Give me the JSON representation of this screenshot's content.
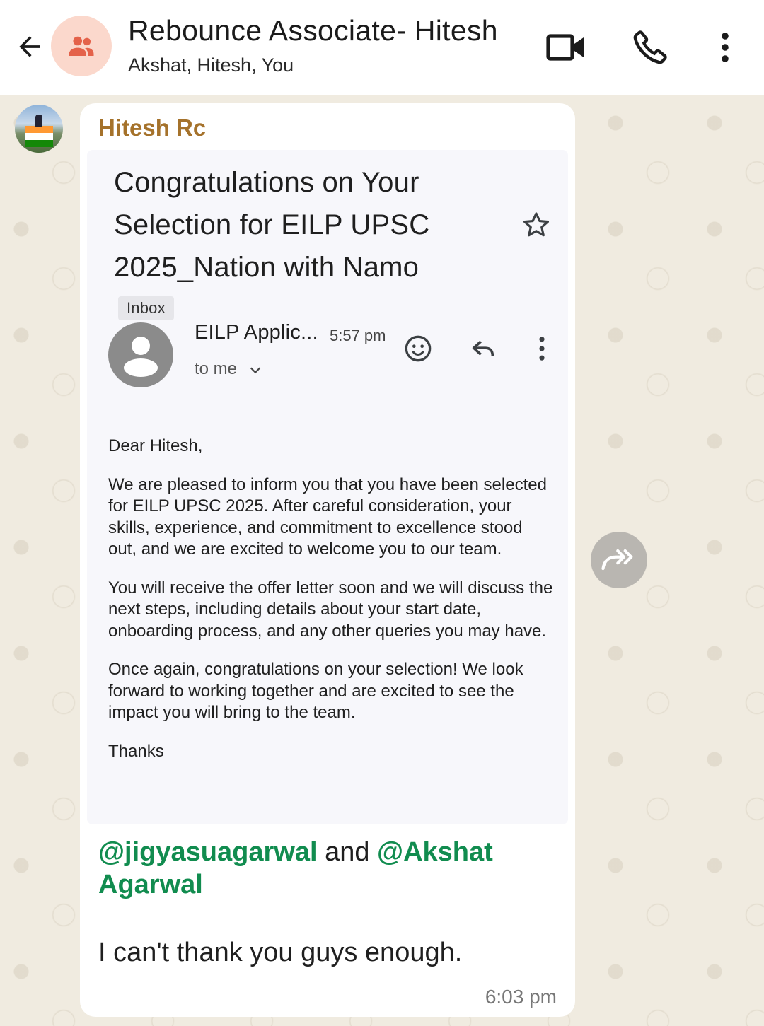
{
  "header": {
    "title": "Rebounce Associate- Hitesh",
    "subtitle": "Akshat, Hitesh, You",
    "back_icon": "arrow-left-icon",
    "group_icon": "group-icon",
    "video_icon": "video-call-icon",
    "call_icon": "phone-icon",
    "menu_icon": "more-vert-icon"
  },
  "message": {
    "sender": "Hitesh Rc",
    "email": {
      "subject": "Congratulations on Your Selection for EILP UPSC 2025_Nation with Namo",
      "label": "Inbox",
      "from": "EILP Applic...",
      "time": "5:57 pm",
      "to": "to me",
      "greeting": "Dear Hitesh,",
      "paragraphs": [
        "We are pleased to inform you that you have been selected for EILP UPSC 2025. After careful consideration, your skills, experience, and commitment to excellence stood out, and we are excited to welcome you to our team.",
        "You will receive the offer letter soon and we will discuss the next steps, including details about your start date, onboarding process, and any other queries you may have.",
        "Once again, congratulations on your selection! We look forward to working together and are excited to see the impact you will bring to the team."
      ],
      "signoff": "Thanks"
    },
    "mention1": "@jigyasuagarwal",
    "conjunction": " and ",
    "mention2": "@Akshat Agarwal",
    "text": "I can't thank you guys enough.",
    "time": "6:03 pm"
  },
  "colors": {
    "sender_name": "#a5722b",
    "mention": "#118c4f",
    "group_avatar_bg": "#fbd8cc",
    "group_icon": "#e4624a"
  }
}
